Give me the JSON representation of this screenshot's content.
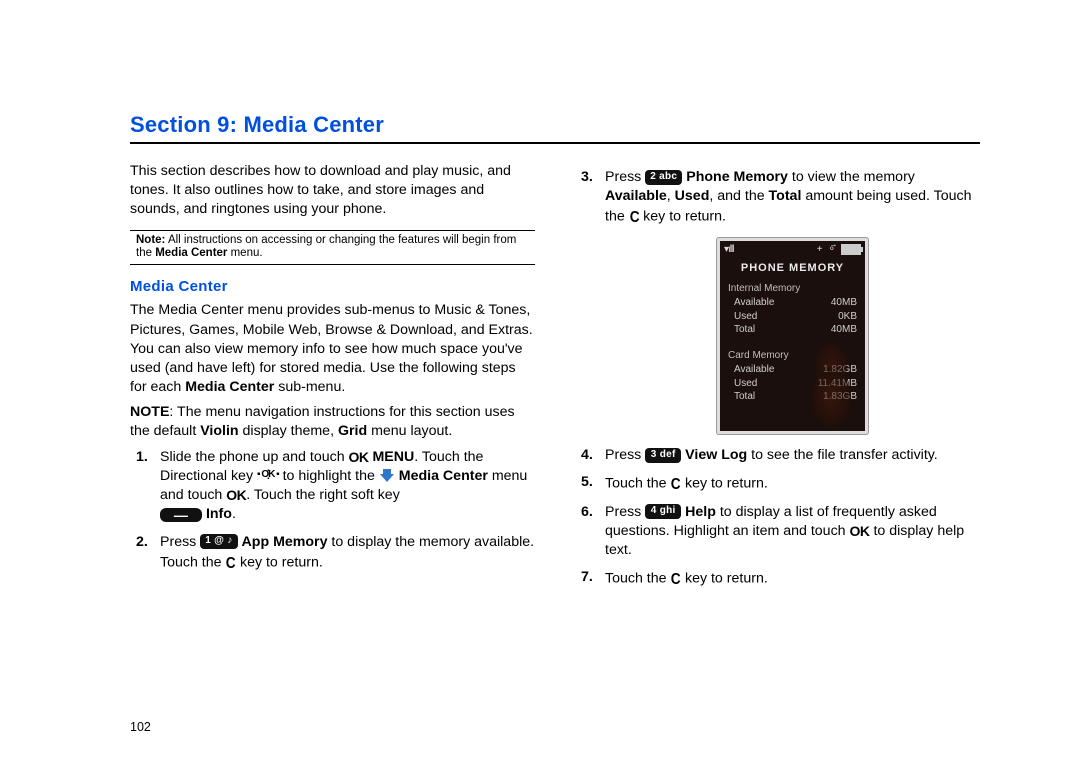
{
  "section_title": "Section 9: Media Center",
  "intro": "This section describes how to download and play music, and tones. It also outlines how to take, and store images and sounds, and ringtones using your phone.",
  "note_label": "Note:",
  "note_text": " All instructions on accessing or changing the features will begin from the ",
  "note_bold": "Media Center",
  "note_tail": " menu.",
  "sub_title": "Media Center",
  "media_p1_a": "The Media Center menu provides sub-menus to Music & Tones, Pictures, Games, Mobile Web, Browse & Download, and Extras. You can also view memory info to see how much space you've used (and have left) for stored media. Use the following steps for each ",
  "media_p1_b": "Media Center",
  "media_p1_c": " sub-menu.",
  "note2_a": "NOTE",
  "note2_b": ": The menu navigation instructions for this section uses the default ",
  "note2_c": "Violin",
  "note2_d": " display theme, ",
  "note2_e": "Grid",
  "note2_f": " menu layout.",
  "step1_a": "Slide the phone up and touch ",
  "step1_menu": " MENU",
  "step1_b": ". Touch the Directional key ",
  "step1_c": " to highlight the ",
  "step1_mc": "Media Center",
  "step1_d": " menu and touch ",
  "step1_e": ".  Touch the right soft key ",
  "step1_info": " Info",
  "step1_f": ".",
  "step2_a": "Press ",
  "key1": "1 @ ♪",
  "step2_b": "App Memory",
  "step2_c": " to display the memory available. Touch the ",
  "step2_d": " key to return.",
  "step3_a": "Press ",
  "key2": "2 abc",
  "step3_b": "Phone Memory",
  "step3_c": " to view the memory ",
  "step3_d": "Available",
  "step3_e": "Used",
  "step3_f": "Total",
  "step3_g": " amount being used. Touch the ",
  "step3_h": " key to return.",
  "step4_a": "Press ",
  "key3": "3 def",
  "step4_b": "View Log",
  "step4_c": " to see the file transfer activity.",
  "step5_a": "Touch the ",
  "step5_b": " key to return.",
  "step6_a": "Press ",
  "key4": "4 ghi",
  "step6_b": "Help",
  "step6_c": " to display a list of frequently asked questions. Highlight an item and touch ",
  "step6_d": " to display help text.",
  "step7_a": "Touch the ",
  "step7_b": " key to return.",
  "page_num": "102",
  "phone": {
    "signal": "▾ılll",
    "plus": "+",
    "title": "PHONE MEMORY",
    "internal": {
      "head": "Internal Memory",
      "rows": [
        {
          "l": "Available",
          "v": "40MB"
        },
        {
          "l": "Used",
          "v": "0KB"
        },
        {
          "l": "Total",
          "v": "40MB"
        }
      ]
    },
    "card": {
      "head": "Card Memory",
      "rows": [
        {
          "l": "Available",
          "v": "1.82GB"
        },
        {
          "l": "Used",
          "v": "11.41MB"
        },
        {
          "l": "Total",
          "v": "1.83GB"
        }
      ]
    }
  }
}
